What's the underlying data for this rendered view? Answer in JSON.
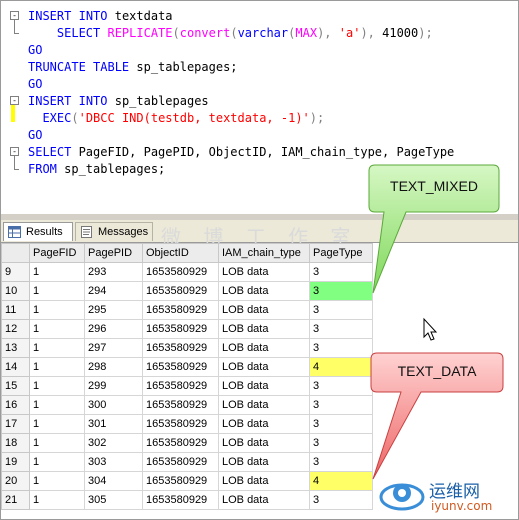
{
  "editor": {
    "lines": [
      [
        {
          "t": "INSERT",
          "c": "kw"
        },
        {
          "t": " ",
          "c": "plain"
        },
        {
          "t": "INTO",
          "c": "kw"
        },
        {
          "t": " textdata",
          "c": "plain"
        }
      ],
      [
        {
          "t": "    SELECT ",
          "c": "kw"
        },
        {
          "t": "REPLICATE",
          "c": "fn"
        },
        {
          "t": "(",
          "c": "gray"
        },
        {
          "t": "convert",
          "c": "fn"
        },
        {
          "t": "(",
          "c": "gray"
        },
        {
          "t": "varchar",
          "c": "kw"
        },
        {
          "t": "(",
          "c": "gray"
        },
        {
          "t": "MAX",
          "c": "fn"
        },
        {
          "t": "), ",
          "c": "gray"
        },
        {
          "t": "'a'",
          "c": "str"
        },
        {
          "t": "), ",
          "c": "gray"
        },
        {
          "t": "41000",
          "c": "plain"
        },
        {
          "t": ");",
          "c": "gray"
        }
      ],
      [
        {
          "t": "GO",
          "c": "kw"
        }
      ],
      [
        {
          "t": "TRUNCATE TABLE",
          "c": "kw"
        },
        {
          "t": " sp_tablepages;",
          "c": "plain"
        }
      ],
      [
        {
          "t": "GO",
          "c": "kw"
        }
      ],
      [
        {
          "t": "INSERT",
          "c": "kw"
        },
        {
          "t": " ",
          "c": "plain"
        },
        {
          "t": "INTO",
          "c": "kw"
        },
        {
          "t": " sp_tablepages",
          "c": "plain"
        }
      ],
      [
        {
          "t": "  EXEC",
          "c": "kw"
        },
        {
          "t": "(",
          "c": "gray"
        },
        {
          "t": "'DBCC IND(testdb, textdata, -1)'",
          "c": "str"
        },
        {
          "t": ");",
          "c": "gray"
        }
      ],
      [
        {
          "t": "GO",
          "c": "kw"
        }
      ],
      [
        {
          "t": "SELECT",
          "c": "kw"
        },
        {
          "t": " PageFID, PagePID, ObjectID, IAM_chain_type, PageType",
          "c": "plain"
        }
      ],
      [
        {
          "t": "FROM",
          "c": "kw"
        },
        {
          "t": " sp_tablepages;",
          "c": "plain"
        }
      ]
    ]
  },
  "tabs": [
    {
      "label": "Results",
      "active": true
    },
    {
      "label": "Messages",
      "active": false
    }
  ],
  "grid": {
    "columns": [
      "",
      "PageFID",
      "PagePID",
      "ObjectID",
      "IAM_chain_type",
      "PageType"
    ],
    "rows": [
      {
        "cells": [
          "9",
          "1",
          "293",
          "1653580929",
          "LOB data",
          "3"
        ],
        "hl": ""
      },
      {
        "cells": [
          "10",
          "1",
          "294",
          "1653580929",
          "LOB data",
          "3"
        ],
        "hl": "green"
      },
      {
        "cells": [
          "11",
          "1",
          "295",
          "1653580929",
          "LOB data",
          "3"
        ],
        "hl": ""
      },
      {
        "cells": [
          "12",
          "1",
          "296",
          "1653580929",
          "LOB data",
          "3"
        ],
        "hl": ""
      },
      {
        "cells": [
          "13",
          "1",
          "297",
          "1653580929",
          "LOB data",
          "3"
        ],
        "hl": ""
      },
      {
        "cells": [
          "14",
          "1",
          "298",
          "1653580929",
          "LOB data",
          "4"
        ],
        "hl": "yellow"
      },
      {
        "cells": [
          "15",
          "1",
          "299",
          "1653580929",
          "LOB data",
          "3"
        ],
        "hl": ""
      },
      {
        "cells": [
          "16",
          "1",
          "300",
          "1653580929",
          "LOB data",
          "3"
        ],
        "hl": ""
      },
      {
        "cells": [
          "17",
          "1",
          "301",
          "1653580929",
          "LOB data",
          "3"
        ],
        "hl": ""
      },
      {
        "cells": [
          "18",
          "1",
          "302",
          "1653580929",
          "LOB data",
          "3"
        ],
        "hl": ""
      },
      {
        "cells": [
          "19",
          "1",
          "303",
          "1653580929",
          "LOB data",
          "3"
        ],
        "hl": ""
      },
      {
        "cells": [
          "20",
          "1",
          "304",
          "1653580929",
          "LOB data",
          "4"
        ],
        "hl": "yellow"
      },
      {
        "cells": [
          "21",
          "1",
          "305",
          "1653580929",
          "LOB data",
          "3"
        ],
        "hl": ""
      }
    ]
  },
  "callouts": {
    "text_mixed": "TEXT_MIXED",
    "text_data": "TEXT_DATA"
  },
  "watermark": {
    "brand": "运维网",
    "url": "iyunv.com",
    "faint_text": "微 博 工 作 室"
  },
  "colors": {
    "green_callout": "#8ee06a",
    "red_callout": "#f07070",
    "highlight_yellow": "#ffff66",
    "highlight_green": "#80ff80"
  }
}
